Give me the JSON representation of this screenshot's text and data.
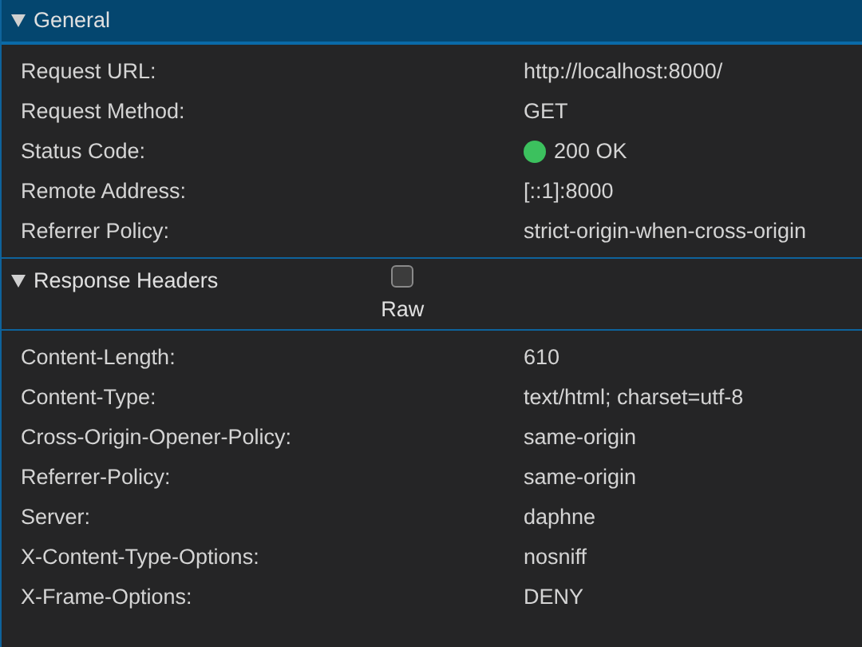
{
  "sections": [
    {
      "title": "General",
      "expanded": true,
      "selected": true,
      "rows": [
        {
          "name": "Request URL:",
          "value": "http://localhost:8000/"
        },
        {
          "name": "Request Method:",
          "value": "GET"
        },
        {
          "name": "Status Code:",
          "value": "200 OK",
          "color": "#3cc15e"
        },
        {
          "name": "Remote Address:",
          "value": "[::1]:8000"
        },
        {
          "name": "Referrer Policy:",
          "value": "strict-origin-when-cross-origin"
        }
      ]
    },
    {
      "title": "Response Headers",
      "expanded": true,
      "selected": false,
      "raw": {
        "label": "Raw",
        "checked": false
      },
      "rows": [
        {
          "name": "Content-Length:",
          "value": "610"
        },
        {
          "name": "Content-Type:",
          "value": "text/html; charset=utf-8"
        },
        {
          "name": "Cross-Origin-Opener-Policy:",
          "value": "same-origin"
        },
        {
          "name": "Referrer-Policy:",
          "value": "same-origin"
        },
        {
          "name": "Server:",
          "value": "daphne"
        },
        {
          "name": "X-Content-Type-Options:",
          "value": "nosniff"
        },
        {
          "name": "X-Frame-Options:",
          "value": "DENY"
        }
      ]
    }
  ]
}
